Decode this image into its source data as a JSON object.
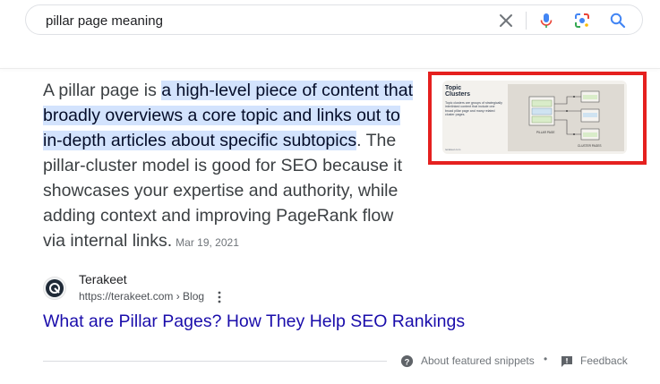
{
  "search": {
    "query": "pillar page meaning"
  },
  "snippet": {
    "lead": "A pillar page is ",
    "highlight": "a high-level piece of content that broadly overviews a core topic and links out to in-depth articles about specific subtopics",
    "rest": ". The pillar-cluster model is good for SEO because it showcases your expertise and authority, while adding context and improving PageRank flow via internal links.",
    "date": "Mar 19, 2021"
  },
  "thumbnail": {
    "title_line1": "Topic",
    "title_line2": "Clusters",
    "body": "Topic clusters are groups of strategically interlinked content that include one broad pillar page and many related cluster pages.",
    "footer": "terakeet.com",
    "label_pillar": "PILLAR PAGE",
    "label_cluster": "CLUSTER PAGES"
  },
  "source": {
    "name": "Terakeet",
    "url": "https://terakeet.com › Blog"
  },
  "result": {
    "title": "What are Pillar Pages? How They Help SEO Rankings"
  },
  "footer": {
    "about": "About featured snippets",
    "separator": "•",
    "feedback": "Feedback"
  },
  "colors": {
    "highlight": "#d3e3fd",
    "link": "#1a0dab",
    "annotation_border": "#e5201f"
  }
}
